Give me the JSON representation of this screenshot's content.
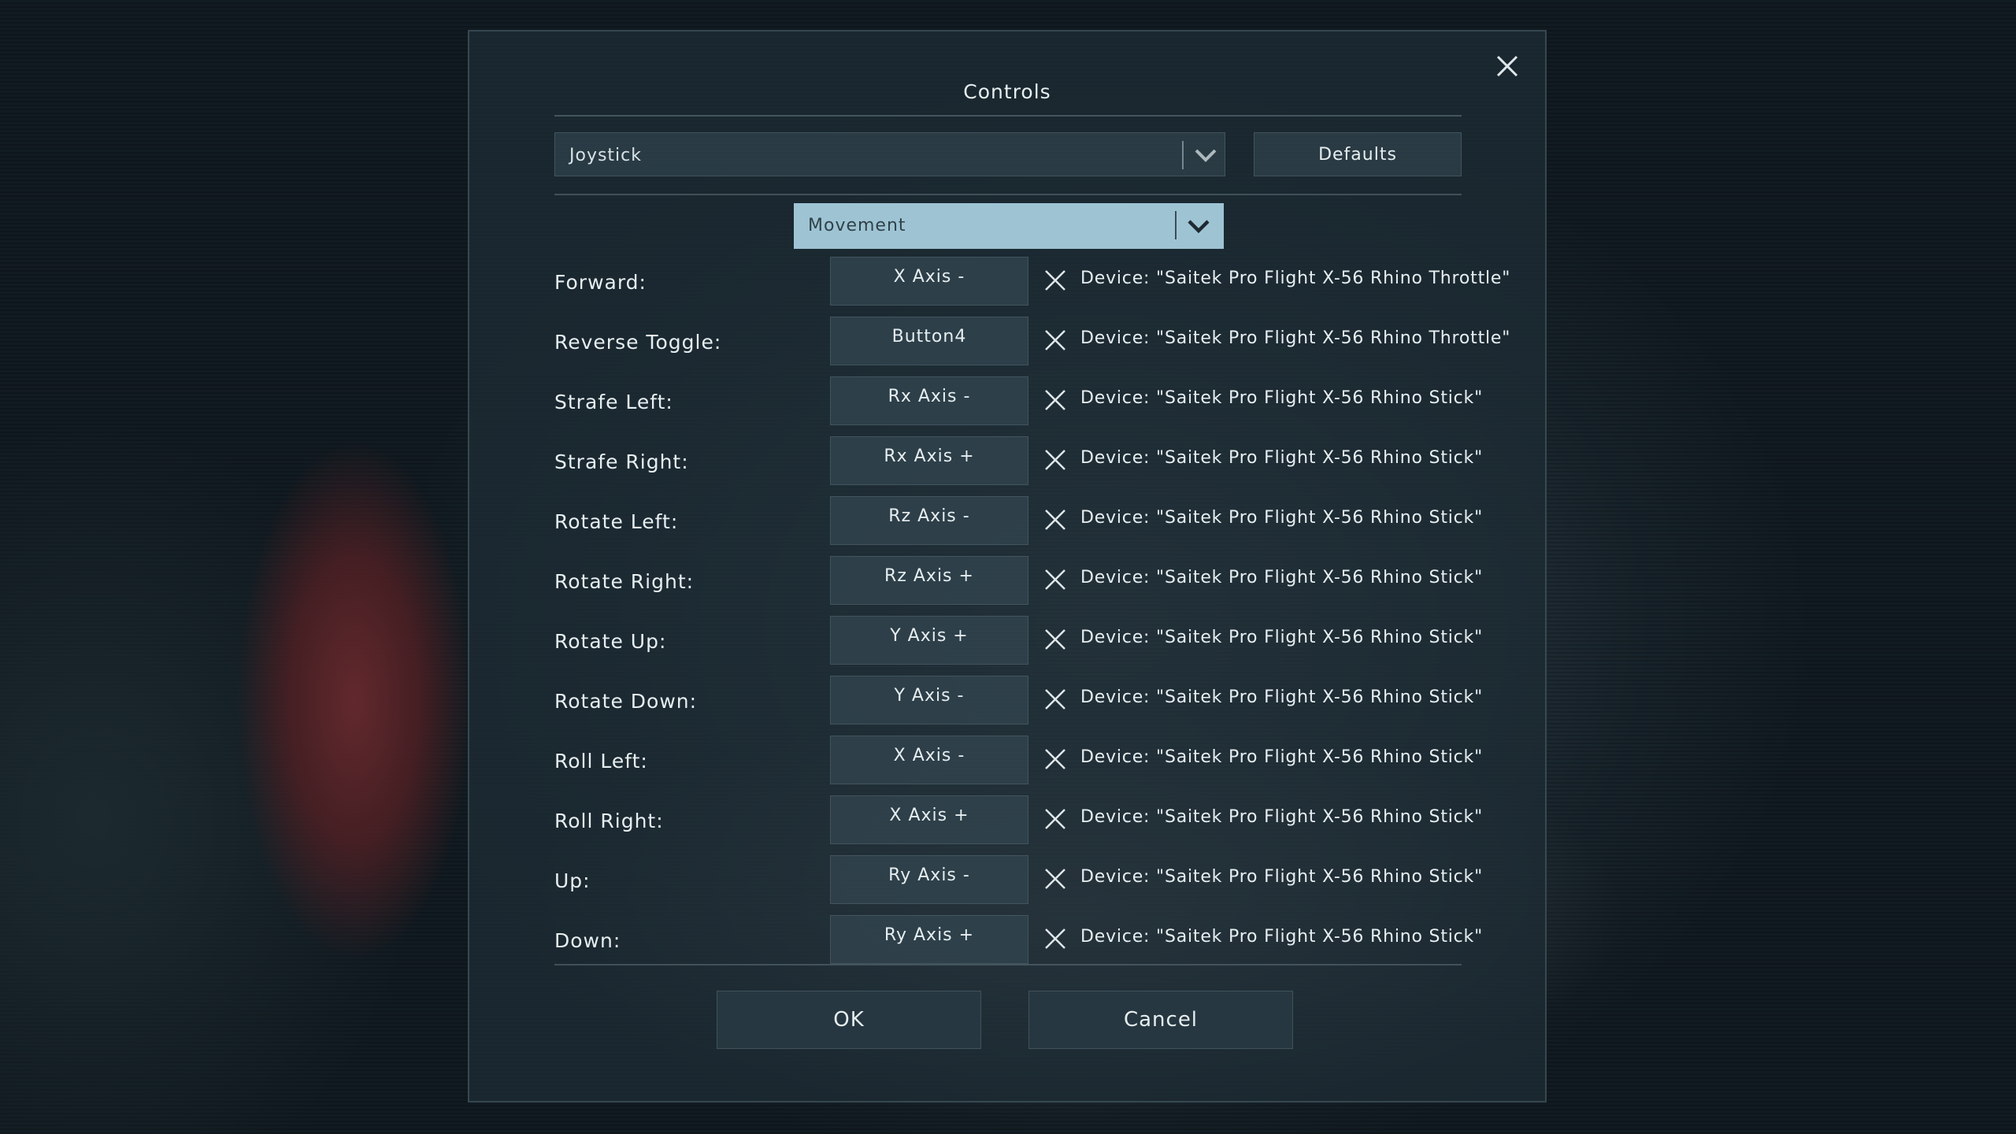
{
  "dialog": {
    "title": "Controls",
    "close_icon": "close-icon"
  },
  "device_select": {
    "value": "Joystick",
    "icon": "chevron-down-icon"
  },
  "defaults_button": {
    "label": "Defaults"
  },
  "category_select": {
    "value": "Movement",
    "icon": "chevron-down-icon"
  },
  "bindings": [
    {
      "action": "Forward:",
      "input": "X Axis -",
      "device": "Device: \"Saitek Pro Flight X-56 Rhino Throttle\""
    },
    {
      "action": "Reverse Toggle:",
      "input": "Button4",
      "device": "Device: \"Saitek Pro Flight X-56 Rhino Throttle\""
    },
    {
      "action": "Strafe Left:",
      "input": "Rx Axis -",
      "device": "Device: \"Saitek Pro Flight X-56 Rhino Stick\""
    },
    {
      "action": "Strafe Right:",
      "input": "Rx Axis +",
      "device": "Device: \"Saitek Pro Flight X-56 Rhino Stick\""
    },
    {
      "action": "Rotate Left:",
      "input": "Rz Axis -",
      "device": "Device: \"Saitek Pro Flight X-56 Rhino Stick\""
    },
    {
      "action": "Rotate Right:",
      "input": "Rz Axis +",
      "device": "Device: \"Saitek Pro Flight X-56 Rhino Stick\""
    },
    {
      "action": "Rotate Up:",
      "input": "Y Axis +",
      "device": "Device: \"Saitek Pro Flight X-56 Rhino Stick\""
    },
    {
      "action": "Rotate Down:",
      "input": "Y Axis -",
      "device": "Device: \"Saitek Pro Flight X-56 Rhino Stick\""
    },
    {
      "action": "Roll Left:",
      "input": "X Axis -",
      "device": "Device: \"Saitek Pro Flight X-56 Rhino Stick\""
    },
    {
      "action": "Roll Right:",
      "input": "X Axis +",
      "device": "Device: \"Saitek Pro Flight X-56 Rhino Stick\""
    },
    {
      "action": "Up:",
      "input": "Ry Axis -",
      "device": "Device: \"Saitek Pro Flight X-56 Rhino Stick\""
    },
    {
      "action": "Down:",
      "input": "Ry Axis +",
      "device": "Device: \"Saitek Pro Flight X-56 Rhino Stick\""
    }
  ],
  "footer": {
    "ok_label": "OK",
    "cancel_label": "Cancel"
  },
  "colors": {
    "accent_select": "#9ec4d4",
    "text": "#e6eef0"
  }
}
